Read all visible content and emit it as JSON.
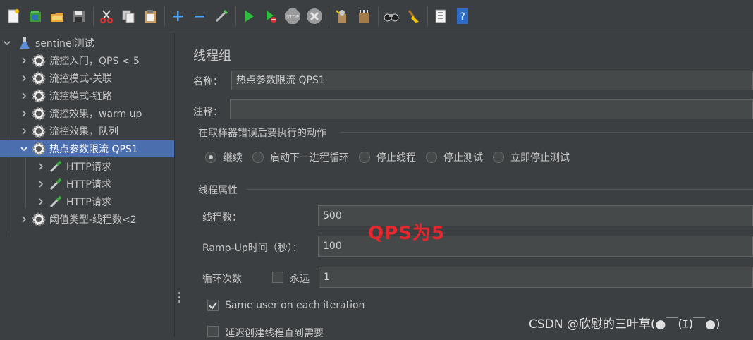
{
  "tree": {
    "root": "sentinel测试",
    "items": [
      {
        "label": "流控入门，QPS < 5"
      },
      {
        "label": "流控模式-关联"
      },
      {
        "label": "流控模式-链路"
      },
      {
        "label": "流控效果，warm up"
      },
      {
        "label": "流控效果，队列"
      },
      {
        "label": "热点参数限流 QPS1",
        "selected": true
      },
      {
        "label": "HTTP请求"
      },
      {
        "label": "HTTP请求"
      },
      {
        "label": "HTTP请求"
      },
      {
        "label": "阈值类型-线程数<2"
      }
    ]
  },
  "panel": {
    "title": "线程组",
    "name_label": "名称：",
    "name_value": "热点参数限流 QPS1",
    "comment_label": "注释：",
    "comment_value": "",
    "error_action_title": "在取样器错误后要执行的动作",
    "error_actions": [
      "继续",
      "启动下一进程循环",
      "停止线程",
      "停止测试",
      "立即停止测试"
    ],
    "error_action_selected": "继续",
    "thread_props_title": "线程属性",
    "threads_label": "线程数：",
    "threads_value": "500",
    "rampup_label": "Ramp-Up时间（秒）：",
    "rampup_value": "100",
    "loops_label": "循环次数",
    "forever_label": "永远",
    "forever_checked": false,
    "loops_value": "1",
    "same_user_label": "Same user on each iteration",
    "same_user_checked": true,
    "delay_label": "延迟创建线程直到需要",
    "delay_checked": false
  },
  "annotation": "QPS为5",
  "watermark": "CSDN @欣慰的三叶草(●￣(ｴ)￣●)",
  "colors": {
    "selected": "#4b6eaf",
    "annotation": "#e8262c"
  }
}
